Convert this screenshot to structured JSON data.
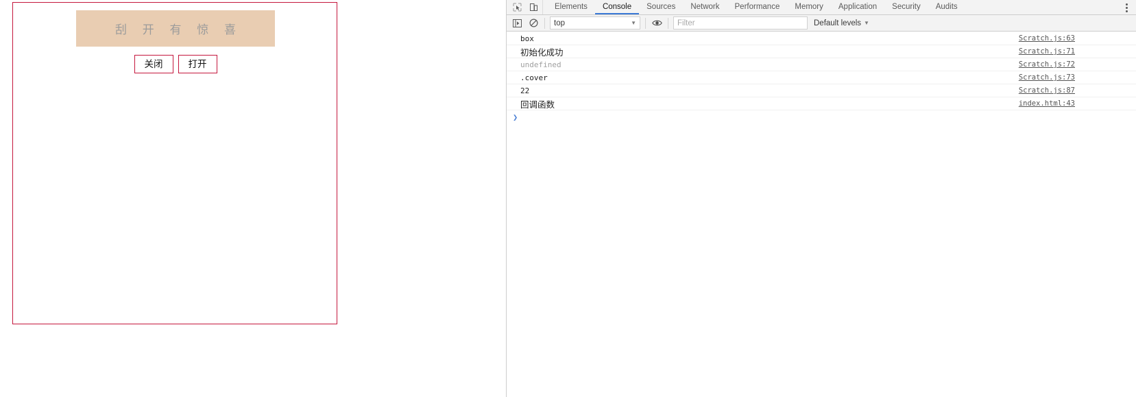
{
  "page": {
    "scratch_card": {
      "cover_text": "刮 开 有 惊 喜",
      "cover_color": "#e9cdb2",
      "text_color": "#9b9b9b"
    },
    "buttons": [
      {
        "label": "关闭",
        "name": "close-button"
      },
      {
        "label": "打开",
        "name": "open-button"
      }
    ],
    "border_color": "#c4163c"
  },
  "devtools": {
    "icons": {
      "inspect": "inspect-element-icon",
      "device": "device-toolbar-icon",
      "more": "more-options-icon",
      "sidebar": "console-sidebar-icon",
      "clear": "clear-console-icon",
      "eye": "live-expression-icon"
    },
    "tabs": [
      {
        "label": "Elements",
        "active": false
      },
      {
        "label": "Console",
        "active": true
      },
      {
        "label": "Sources",
        "active": false
      },
      {
        "label": "Network",
        "active": false
      },
      {
        "label": "Performance",
        "active": false
      },
      {
        "label": "Memory",
        "active": false
      },
      {
        "label": "Application",
        "active": false
      },
      {
        "label": "Security",
        "active": false
      },
      {
        "label": "Audits",
        "active": false
      }
    ],
    "active_tab_color": "#3a79d6",
    "filter_bar": {
      "context": "top",
      "filter_placeholder": "Filter",
      "filter_value": "",
      "levels": "Default levels",
      "caret": "▼"
    },
    "console_messages": [
      {
        "text": "box",
        "source": "Scratch.js:63",
        "dim": false,
        "cjk": false
      },
      {
        "text": "初始化成功",
        "source": "Scratch.js:71",
        "dim": false,
        "cjk": true
      },
      {
        "text": "undefined",
        "source": "Scratch.js:72",
        "dim": true,
        "cjk": false
      },
      {
        "text": ".cover",
        "source": "Scratch.js:73",
        "dim": false,
        "cjk": false
      },
      {
        "text": "22",
        "source": "Scratch.js:87",
        "dim": false,
        "cjk": false
      },
      {
        "text": "回调函数",
        "source": "index.html:43",
        "dim": false,
        "cjk": true
      }
    ],
    "prompt_caret": "❯"
  }
}
